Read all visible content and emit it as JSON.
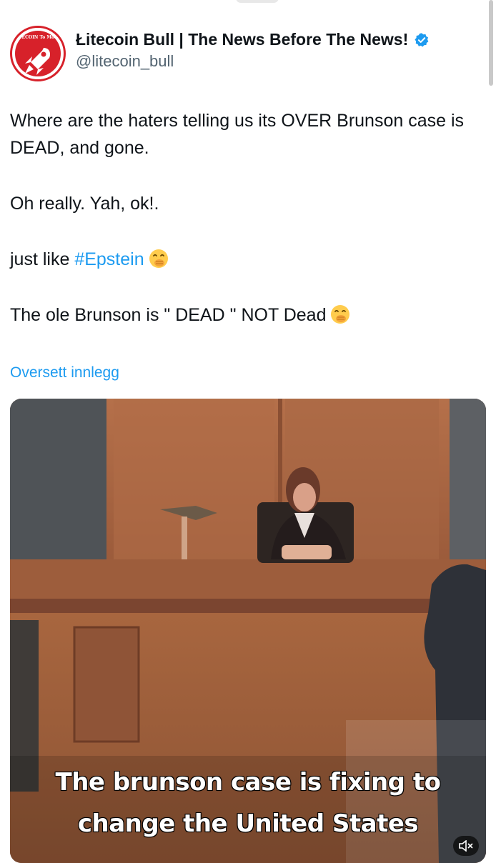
{
  "author": {
    "display_name": "Łitecoin Bull | The News Before The News!",
    "handle": "@litecoin_bull",
    "avatar_text": "LITECOIN To Moon!",
    "verified": true
  },
  "tweet": {
    "line1": "Where are the haters telling us its OVER Brunson case is DEAD, and gone.",
    "line2": "Oh really. Yah, ok!.",
    "line3_prefix": "just like ",
    "line3_hashtag": "#Epstein",
    "line4": "The ole Brunson is \" DEAD \" NOT Dead",
    "emoji": "face-with-hand-over-mouth"
  },
  "translate_link": "Oversett innlegg",
  "media": {
    "caption_line1": "The brunson case is fixing to",
    "caption_line2": "change the United States",
    "mute_icon": "speaker-muted-icon"
  },
  "colors": {
    "link": "#1d9bf0",
    "text": "#0f1419",
    "secondary": "#536471",
    "avatar_red": "#d7212a"
  }
}
